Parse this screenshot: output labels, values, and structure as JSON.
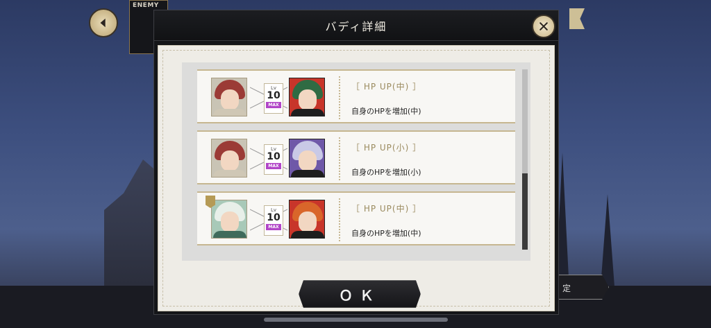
{
  "hud": {
    "enemy_label": "ENEMY"
  },
  "modal": {
    "title": "バディ詳細",
    "ok_label": "ＯＫ"
  },
  "buddies": [
    {
      "level_label": "Lv",
      "level": "10",
      "max_label": "MAX",
      "skill": "［ HP UP(中) ］",
      "description": "自身のHPを増加(中)",
      "left_colors": {
        "hair": "#9b3b36",
        "body": "#cfc7b5",
        "bg": "#c9c4b5"
      },
      "right_colors": {
        "hair": "#2f6b43",
        "body": "#1e1e1e",
        "bg": "#c8352a"
      }
    },
    {
      "level_label": "Lv",
      "level": "10",
      "max_label": "MAX",
      "skill": "［ HP UP(小) ］",
      "description": "自身のHPを増加(小)",
      "left_colors": {
        "hair": "#9b3b36",
        "body": "#cfc7b5",
        "bg": "#c9c4b5"
      },
      "right_colors": {
        "hair": "#c9c9e6",
        "body": "#1e1e1e",
        "bg": "#6f58a8"
      }
    },
    {
      "level_label": "Lv",
      "level": "10",
      "max_label": "MAX",
      "skill": "［ HP UP(中) ］",
      "description": "自身のHPを増加(中)",
      "left_colors": {
        "hair": "#e8efe9",
        "body": "#3f6b5c",
        "bg": "#a8c9b8"
      },
      "right_colors": {
        "hair": "#d9662a",
        "body": "#1e1e1e",
        "bg": "#c8352a"
      }
    }
  ],
  "icons": {
    "back": "chevron-left-icon",
    "close": "close-icon"
  }
}
